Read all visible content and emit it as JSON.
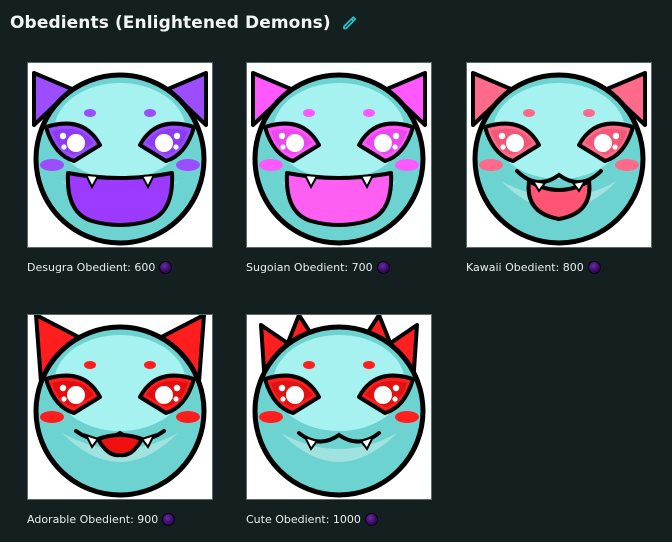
{
  "header": {
    "title": "Obedients (Enlightened Demons)",
    "edit_icon": "pencil-icon"
  },
  "currency_icon": "purple-orb-icon",
  "colors": {
    "background": "#142020",
    "face": "#6dd3d0",
    "face_light": "#a6f2f0",
    "accent_link": "#27c2c8"
  },
  "items": [
    {
      "name": "Desugra Obedient",
      "label": "Desugra Obedient: 600",
      "price": 600,
      "accent": "#9b4dff",
      "accent_dark": "#7a2ae0",
      "mouth": "#9c3bff"
    },
    {
      "name": "Sugoian Obedient",
      "label": "Sugoian Obedient: 700",
      "price": 700,
      "accent": "#ff58ff",
      "accent_dark": "#d03ad6",
      "mouth": "#ff5ef2"
    },
    {
      "name": "Kawaii Obedient",
      "label": "Kawaii Obedient: 800",
      "price": 800,
      "accent": "#ff6a8a",
      "accent_dark": "#e0405f",
      "mouth": "#ff5573"
    },
    {
      "name": "Adorable Obedient",
      "label": "Adorable Obedient: 900",
      "price": 900,
      "accent": "#ff1d1d",
      "accent_dark": "#c20000",
      "mouth": "#f01010"
    },
    {
      "name": "Cute Obedient",
      "label": "Cute Obedient: 1000",
      "price": 1000,
      "accent": "#ff1f1f",
      "accent_dark": "#c00000",
      "mouth": "#ff2a2a"
    }
  ]
}
